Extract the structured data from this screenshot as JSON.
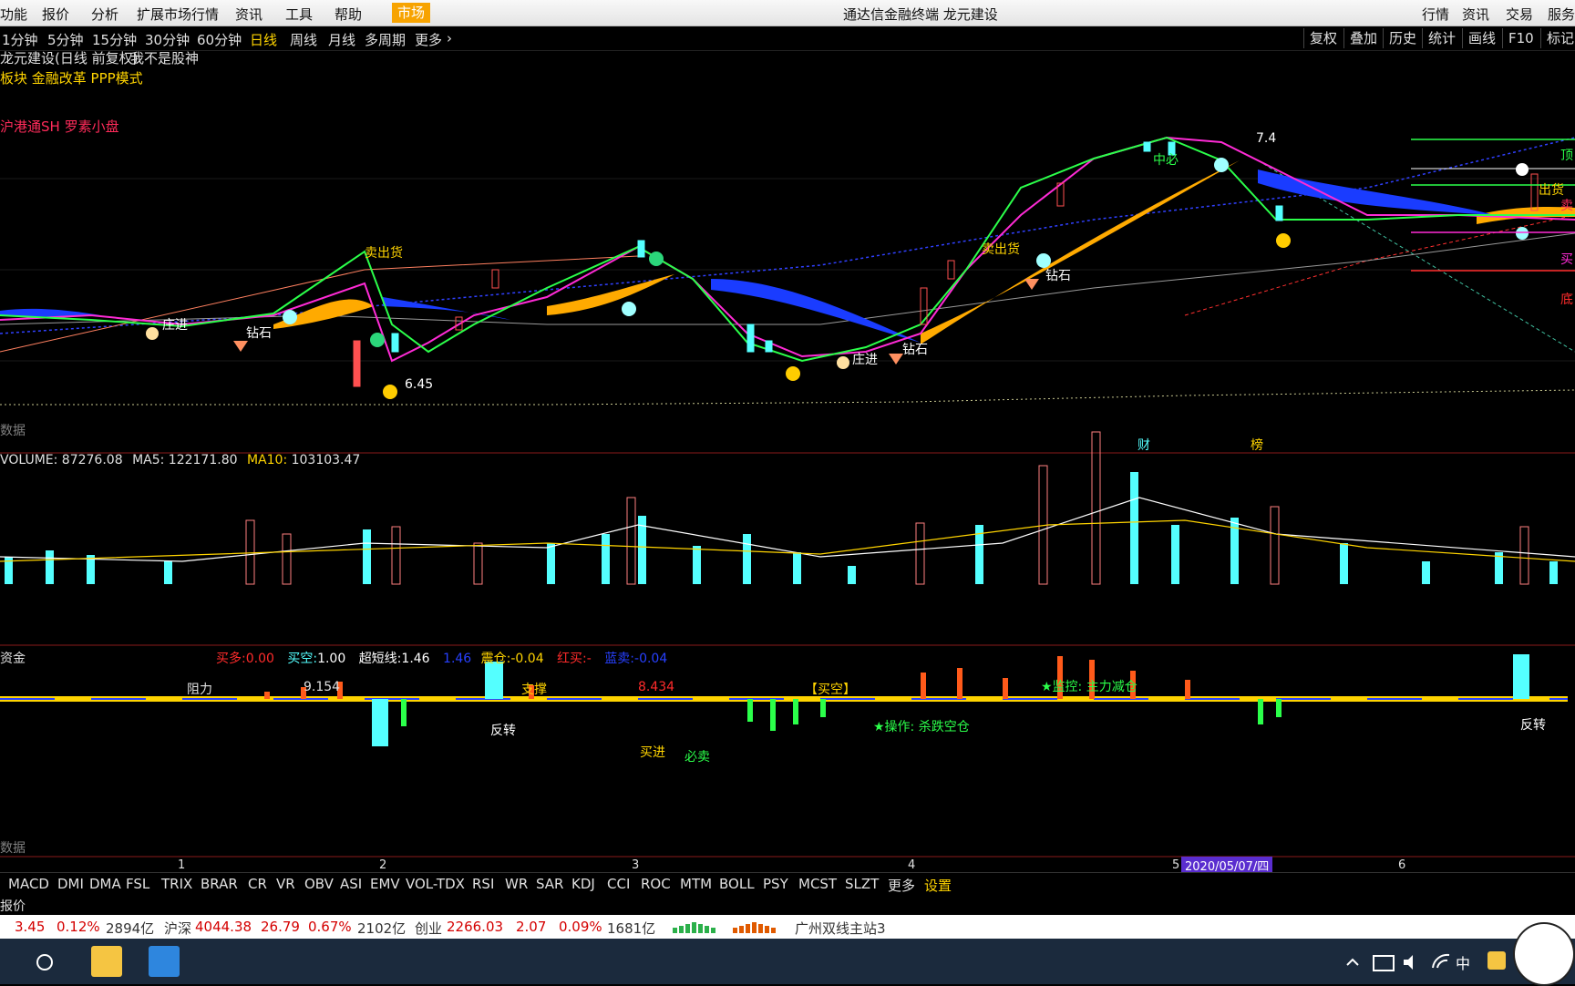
{
  "menu": {
    "items": [
      "功能",
      "报价",
      "分析",
      "扩展市场行情",
      "资讯",
      "工具",
      "帮助"
    ],
    "active_tab": "市场",
    "window_title": "通达信金融终端 龙元建设",
    "right_items": [
      "行情",
      "资讯",
      "交易",
      "服务"
    ]
  },
  "periods": {
    "items": [
      "1分钟",
      "5分钟",
      "15分钟",
      "30分钟",
      "60分钟",
      "日线",
      "周线",
      "月线",
      "多周期",
      "更多"
    ],
    "active": "日线",
    "more_arrow": "›",
    "right_tools": [
      "复权",
      "叠加",
      "历史",
      "统计",
      "画线",
      "F10",
      "标记"
    ]
  },
  "main_chart": {
    "stock_title": "龙元建设(日线 前复权)",
    "tag": "我不是股神",
    "sector_line": "板块 金融改革 PPP模式",
    "tag_line": "沪港通SH 罗素小盘",
    "labels": {
      "sell_goods": "卖出货",
      "zhuang_jin": "庄进",
      "zuan_shi": "钻石",
      "zhong_bi": "中必",
      "low_price": "6.45",
      "peak_price": "7.4",
      "fundamentals": "财",
      "announce": "榜",
      "data_label": "数据",
      "top": "顶",
      "sell_goods_right": "出货",
      "sell": "卖",
      "buy": "买",
      "bottom": "底"
    }
  },
  "volume_panel": {
    "vol_label": "VOLUME:",
    "vol_value": "87276.08",
    "ma5_label": "MA5:",
    "ma5_value": "122171.80",
    "ma10_label": "MA10:",
    "ma10_value": "103103.47"
  },
  "indicator_panel": {
    "name": "资金",
    "buy_more_label": "买多:",
    "buy_more_value": "0.00",
    "buy_empty_label": "买空:",
    "buy_empty_value": "1.00",
    "super_short_label": "超短线:",
    "super_short_value": "1.46",
    "extra_value": "1.46",
    "shake_label": "震仓:",
    "shake_value": "-0.04",
    "red_buy_label": "红买:",
    "red_buy_value": "-",
    "blue_sell_label": "蓝卖:",
    "blue_sell_value": "-0.04",
    "resist_label": "阻力",
    "resist_value": "9.154",
    "support_label": "支撑",
    "support_value": "8.434",
    "bracket_label": "【买空】",
    "monitor_label": "★监控: 主力减仓",
    "operate_label": "★操作: 杀跌空仓",
    "reversal": "反转",
    "buy_in": "买进",
    "must_sell": "必卖",
    "data_label": "数据"
  },
  "date_axis": {
    "months": [
      "1",
      "2",
      "3",
      "4",
      "5",
      "6"
    ],
    "highlight_date": "2020/05/07/四"
  },
  "indicators": {
    "tabs": [
      "MACD",
      "DMI",
      "DMA",
      "FSL",
      "TRIX",
      "BRAR",
      "CR",
      "VR",
      "OBV",
      "ASI",
      "EMV",
      "VOL-TDX",
      "RSI",
      "WR",
      "SAR",
      "KDJ",
      "CCI",
      "ROC",
      "MTM",
      "BOLL",
      "PSY",
      "MCST",
      "SLZT",
      "更多",
      "设置"
    ],
    "active": "设置",
    "bottom_label": "报价"
  },
  "quote_bar": {
    "sh_val": "3.45",
    "sh_pct": "0.12%",
    "sh_amt": "2894亿",
    "hs_label": "沪深",
    "hs_index": "4044.38",
    "hs_chg": "26.79",
    "hs_pct": "0.67%",
    "hs_amt": "2102亿",
    "cy_label": "创业",
    "cy_index": "2266.03",
    "cy_chg": "2.07",
    "cy_pct": "0.09%",
    "cy_amt": "1681亿",
    "server": "广州双线主站3"
  },
  "taskbar": {
    "ime": "中"
  },
  "colors": {
    "menu_active": "#f7a300",
    "up": "#ff5050",
    "down": "#54ffff",
    "yellow": "#ffd400",
    "orange_band": "#ffaa00",
    "blue_band": "#1a3cff",
    "magenta": "#ff2bd6",
    "green": "#2bff4a"
  }
}
